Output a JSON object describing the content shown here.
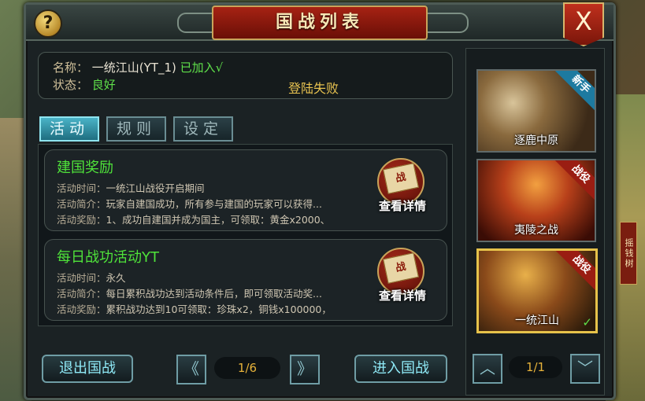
{
  "header": {
    "title": "国战列表",
    "help_glyph": "?",
    "close_glyph": "X"
  },
  "server": {
    "name_label": "名称：",
    "name_value": "一统江山(YT_1)",
    "joined_text": "已加入√",
    "status_label": "状态：",
    "status_value": "良好",
    "login_message": "登陆失败"
  },
  "tabs": [
    {
      "label": "活动",
      "active": true
    },
    {
      "label": "规则",
      "active": false
    },
    {
      "label": "设定",
      "active": false
    }
  ],
  "activities": [
    {
      "title": "建国奖励",
      "time_label": "活动时间：",
      "time_value": "一统江山战役开启期间",
      "desc_label": "活动简介：",
      "desc_value": "玩家自建国成功，所有参与建国的玩家可以获得...",
      "reward_label": "活动奖励：",
      "reward_value": "1、成功自建国并成为国主，可领取：黄金x2000、",
      "detail_label": "查看详情",
      "detail_icon_glyph": "战"
    },
    {
      "title": "每日战功活动YT",
      "time_label": "活动时间：",
      "time_value": "永久",
      "desc_label": "活动简介：",
      "desc_value": "每日累积战功达到活动条件后，即可领取活动奖...",
      "reward_label": "活动奖励：",
      "reward_value": "累积战功达到10可领取：珍珠x2，铜钱x100000，",
      "detail_label": "查看详情",
      "detail_icon_glyph": "战"
    }
  ],
  "footer": {
    "exit_label": "退出国战",
    "prev_glyph": "《",
    "next_glyph": "》",
    "page_text": "1/6",
    "enter_label": "进入国战"
  },
  "battles": [
    {
      "name": "逐鹿中原",
      "tag": "新手",
      "tag_type": "new",
      "selected": false
    },
    {
      "name": "夷陵之战",
      "tag": "战役",
      "tag_type": "war",
      "selected": false
    },
    {
      "name": "一统江山",
      "tag": "战役",
      "tag_type": "war",
      "selected": true,
      "check": "✓"
    }
  ],
  "battle_pager": {
    "up_glyph": "︿",
    "down_glyph": "﹀",
    "page_text": "1/1"
  },
  "background": {
    "sign_text": "摇钱树"
  },
  "colors": {
    "accent_green": "#5fe04a",
    "accent_gold": "#e6b23a",
    "tab_active": "#4ab3c7",
    "title_red": "#a62213"
  }
}
